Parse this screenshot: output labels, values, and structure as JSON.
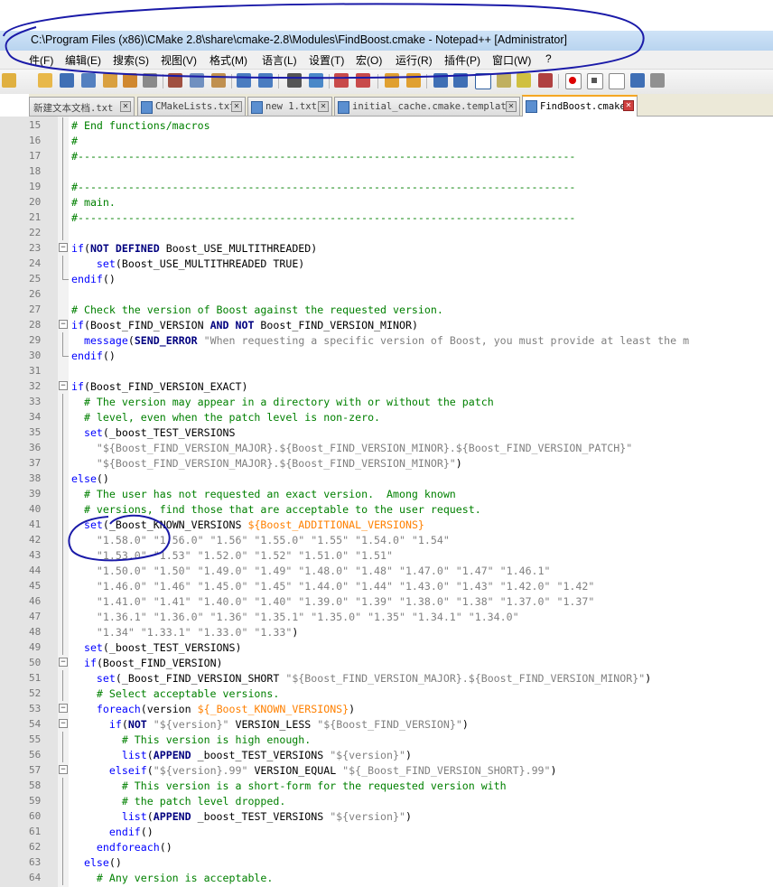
{
  "window": {
    "title": "C:\\Program Files (x86)\\CMake 2.8\\share\\cmake-2.8\\Modules\\FindBoost.cmake - Notepad++ [Administrator]"
  },
  "menu": [
    "件(F)",
    "编辑(E)",
    "搜索(S)",
    "视图(V)",
    "格式(M)",
    "语言(L)",
    "设置(T)",
    "宏(O)",
    "运行(R)",
    "插件(P)",
    "窗口(W)",
    "?"
  ],
  "tabs": [
    {
      "label": "新建文本文档.txt",
      "active": false
    },
    {
      "label": "CMakeLists.txt",
      "active": false
    },
    {
      "label": "new 1.txt",
      "active": false
    },
    {
      "label": "initial_cache.cmake.template",
      "active": false
    },
    {
      "label": "FindBoost.cmake",
      "active": true
    }
  ],
  "icons": {
    "close": "close-icon",
    "file": "file-icon"
  },
  "colors": {
    "comment": "#008000",
    "keyword": "#0000ff",
    "string": "#808080",
    "variable": "#ff8000",
    "annotation": "#1a1aa8",
    "active_tab_accent": "#f5a623"
  },
  "editor": {
    "lines": [
      {
        "n": "15",
        "fold": "line",
        "tokens": [
          [
            "cm",
            "# End functions/macros"
          ]
        ]
      },
      {
        "n": "16",
        "fold": "line",
        "tokens": [
          [
            "cm",
            "#"
          ]
        ]
      },
      {
        "n": "17",
        "fold": "line",
        "tokens": [
          [
            "cm",
            "#-------------------------------------------------------------------------------"
          ]
        ]
      },
      {
        "n": "18",
        "fold": "line",
        "tokens": []
      },
      {
        "n": "19",
        "fold": "line",
        "tokens": [
          [
            "cm",
            "#-------------------------------------------------------------------------------"
          ]
        ]
      },
      {
        "n": "20",
        "fold": "line",
        "tokens": [
          [
            "cm",
            "# main."
          ]
        ]
      },
      {
        "n": "21",
        "fold": "line",
        "tokens": [
          [
            "cm",
            "#-------------------------------------------------------------------------------"
          ]
        ]
      },
      {
        "n": "22",
        "fold": "line",
        "tokens": []
      },
      {
        "n": "23",
        "fold": "open",
        "tokens": [
          [
            "kw",
            "if"
          ],
          [
            "pl",
            "("
          ],
          [
            "kw2",
            "NOT DEFINED"
          ],
          [
            "pl",
            " Boost_USE_MULTITHREADED)"
          ]
        ]
      },
      {
        "n": "24",
        "fold": "line",
        "tokens": [
          [
            "pl",
            "    "
          ],
          [
            "kw",
            "set"
          ],
          [
            "pl",
            "(Boost_USE_MULTITHREADED TRUE)"
          ]
        ]
      },
      {
        "n": "25",
        "fold": "end",
        "tokens": [
          [
            "kw",
            "endif"
          ],
          [
            "pl",
            "()"
          ]
        ]
      },
      {
        "n": "26",
        "fold": "none",
        "tokens": []
      },
      {
        "n": "27",
        "fold": "none",
        "tokens": [
          [
            "cm",
            "# Check the version of Boost against the requested version."
          ]
        ]
      },
      {
        "n": "28",
        "fold": "open",
        "tokens": [
          [
            "kw",
            "if"
          ],
          [
            "pl",
            "(Boost_FIND_VERSION "
          ],
          [
            "kw2",
            "AND NOT"
          ],
          [
            "pl",
            " Boost_FIND_VERSION_MINOR)"
          ]
        ]
      },
      {
        "n": "29",
        "fold": "line",
        "tokens": [
          [
            "pl",
            "  "
          ],
          [
            "kw",
            "message"
          ],
          [
            "pl",
            "("
          ],
          [
            "kw2",
            "SEND_ERROR"
          ],
          [
            "str",
            " \"When requesting a specific version of Boost, you must provide at least the m"
          ]
        ]
      },
      {
        "n": "30",
        "fold": "end",
        "tokens": [
          [
            "kw",
            "endif"
          ],
          [
            "pl",
            "()"
          ]
        ]
      },
      {
        "n": "31",
        "fold": "none",
        "tokens": []
      },
      {
        "n": "32",
        "fold": "open",
        "tokens": [
          [
            "kw",
            "if"
          ],
          [
            "pl",
            "(Boost_FIND_VERSION_EXACT)"
          ]
        ]
      },
      {
        "n": "33",
        "fold": "line",
        "tokens": [
          [
            "pl",
            "  "
          ],
          [
            "cm",
            "# The version may appear in a directory with or without the patch"
          ]
        ]
      },
      {
        "n": "34",
        "fold": "line",
        "tokens": [
          [
            "pl",
            "  "
          ],
          [
            "cm",
            "# level, even when the patch level is non-zero."
          ]
        ]
      },
      {
        "n": "35",
        "fold": "line",
        "tokens": [
          [
            "pl",
            "  "
          ],
          [
            "kw",
            "set"
          ],
          [
            "pl",
            "(_boost_TEST_VERSIONS"
          ]
        ]
      },
      {
        "n": "36",
        "fold": "line",
        "tokens": [
          [
            "pl",
            "    "
          ],
          [
            "str",
            "\"${Boost_FIND_VERSION_MAJOR}.${Boost_FIND_VERSION_MINOR}.${Boost_FIND_VERSION_PATCH}\""
          ]
        ]
      },
      {
        "n": "37",
        "fold": "line",
        "tokens": [
          [
            "pl",
            "    "
          ],
          [
            "str",
            "\"${Boost_FIND_VERSION_MAJOR}.${Boost_FIND_VERSION_MINOR}\""
          ],
          [
            "pl",
            ")"
          ]
        ]
      },
      {
        "n": "38",
        "fold": "line",
        "tokens": [
          [
            "kw",
            "else"
          ],
          [
            "pl",
            "()"
          ]
        ]
      },
      {
        "n": "39",
        "fold": "line",
        "tokens": [
          [
            "pl",
            "  "
          ],
          [
            "cm",
            "# The user has not requested an exact version.  Among known"
          ]
        ]
      },
      {
        "n": "40",
        "fold": "line",
        "tokens": [
          [
            "pl",
            "  "
          ],
          [
            "cm",
            "# versions, find those that are acceptable to the user request."
          ]
        ]
      },
      {
        "n": "41",
        "fold": "line",
        "tokens": [
          [
            "pl",
            "  "
          ],
          [
            "kw",
            "set"
          ],
          [
            "pl",
            "(_Boost_KNOWN_VERSIONS "
          ],
          [
            "var",
            "${Boost_ADDITIONAL_VERSIONS}"
          ]
        ]
      },
      {
        "n": "42",
        "fold": "line",
        "tokens": [
          [
            "pl",
            "    "
          ],
          [
            "str",
            "\"1.58.0\" \"1.56.0\" \"1.56\" \"1.55.0\" \"1.55\" \"1.54.0\" \"1.54\""
          ]
        ]
      },
      {
        "n": "43",
        "fold": "line",
        "tokens": [
          [
            "pl",
            "    "
          ],
          [
            "str",
            "\"1.53.0\" \"1.53\" \"1.52.0\" \"1.52\" \"1.51.0\" \"1.51\""
          ]
        ]
      },
      {
        "n": "44",
        "fold": "line",
        "tokens": [
          [
            "pl",
            "    "
          ],
          [
            "str",
            "\"1.50.0\" \"1.50\" \"1.49.0\" \"1.49\" \"1.48.0\" \"1.48\" \"1.47.0\" \"1.47\" \"1.46.1\""
          ]
        ]
      },
      {
        "n": "45",
        "fold": "line",
        "tokens": [
          [
            "pl",
            "    "
          ],
          [
            "str",
            "\"1.46.0\" \"1.46\" \"1.45.0\" \"1.45\" \"1.44.0\" \"1.44\" \"1.43.0\" \"1.43\" \"1.42.0\" \"1.42\""
          ]
        ]
      },
      {
        "n": "46",
        "fold": "line",
        "tokens": [
          [
            "pl",
            "    "
          ],
          [
            "str",
            "\"1.41.0\" \"1.41\" \"1.40.0\" \"1.40\" \"1.39.0\" \"1.39\" \"1.38.0\" \"1.38\" \"1.37.0\" \"1.37\""
          ]
        ]
      },
      {
        "n": "47",
        "fold": "line",
        "tokens": [
          [
            "pl",
            "    "
          ],
          [
            "str",
            "\"1.36.1\" \"1.36.0\" \"1.36\" \"1.35.1\" \"1.35.0\" \"1.35\" \"1.34.1\" \"1.34.0\""
          ]
        ]
      },
      {
        "n": "48",
        "fold": "line",
        "tokens": [
          [
            "pl",
            "    "
          ],
          [
            "str",
            "\"1.34\" \"1.33.1\" \"1.33.0\" \"1.33\""
          ],
          [
            "pl",
            ")"
          ]
        ]
      },
      {
        "n": "49",
        "fold": "line",
        "tokens": [
          [
            "pl",
            "  "
          ],
          [
            "kw",
            "set"
          ],
          [
            "pl",
            "(_boost_TEST_VERSIONS)"
          ]
        ]
      },
      {
        "n": "50",
        "fold": "open",
        "tokens": [
          [
            "pl",
            "  "
          ],
          [
            "kw",
            "if"
          ],
          [
            "pl",
            "(Boost_FIND_VERSION)"
          ]
        ]
      },
      {
        "n": "51",
        "fold": "line",
        "tokens": [
          [
            "pl",
            "    "
          ],
          [
            "kw",
            "set"
          ],
          [
            "pl",
            "(_Boost_FIND_VERSION_SHORT "
          ],
          [
            "str",
            "\"${Boost_FIND_VERSION_MAJOR}.${Boost_FIND_VERSION_MINOR}\""
          ],
          [
            "pl",
            ")"
          ]
        ]
      },
      {
        "n": "52",
        "fold": "line",
        "tokens": [
          [
            "pl",
            "    "
          ],
          [
            "cm",
            "# Select acceptable versions."
          ]
        ]
      },
      {
        "n": "53",
        "fold": "open",
        "tokens": [
          [
            "pl",
            "    "
          ],
          [
            "kw",
            "foreach"
          ],
          [
            "pl",
            "(version "
          ],
          [
            "var",
            "${_Boost_KNOWN_VERSIONS}"
          ],
          [
            "pl",
            ")"
          ]
        ]
      },
      {
        "n": "54",
        "fold": "open",
        "tokens": [
          [
            "pl",
            "      "
          ],
          [
            "kw",
            "if"
          ],
          [
            "pl",
            "("
          ],
          [
            "kw2",
            "NOT"
          ],
          [
            "str",
            " \"${version}\""
          ],
          [
            "pl",
            " VERSION_LESS "
          ],
          [
            "str",
            "\"${Boost_FIND_VERSION}\""
          ],
          [
            "pl",
            ")"
          ]
        ]
      },
      {
        "n": "55",
        "fold": "line",
        "tokens": [
          [
            "pl",
            "        "
          ],
          [
            "cm",
            "# This version is high enough."
          ]
        ]
      },
      {
        "n": "56",
        "fold": "line",
        "tokens": [
          [
            "pl",
            "        "
          ],
          [
            "kw",
            "list"
          ],
          [
            "pl",
            "("
          ],
          [
            "kw2",
            "APPEND"
          ],
          [
            "pl",
            " _boost_TEST_VERSIONS "
          ],
          [
            "str",
            "\"${version}\""
          ],
          [
            "pl",
            ")"
          ]
        ]
      },
      {
        "n": "57",
        "fold": "open",
        "tokens": [
          [
            "pl",
            "      "
          ],
          [
            "kw",
            "elseif"
          ],
          [
            "pl",
            "("
          ],
          [
            "str",
            "\"${version}.99\""
          ],
          [
            "pl",
            " VERSION_EQUAL "
          ],
          [
            "str",
            "\"${_Boost_FIND_VERSION_SHORT}.99\""
          ],
          [
            "pl",
            ")"
          ]
        ]
      },
      {
        "n": "58",
        "fold": "line",
        "tokens": [
          [
            "pl",
            "        "
          ],
          [
            "cm",
            "# This version is a short-form for the requested version with"
          ]
        ]
      },
      {
        "n": "59",
        "fold": "line",
        "tokens": [
          [
            "pl",
            "        "
          ],
          [
            "cm",
            "# the patch level dropped."
          ]
        ]
      },
      {
        "n": "60",
        "fold": "line",
        "tokens": [
          [
            "pl",
            "        "
          ],
          [
            "kw",
            "list"
          ],
          [
            "pl",
            "("
          ],
          [
            "kw2",
            "APPEND"
          ],
          [
            "pl",
            " _boost_TEST_VERSIONS "
          ],
          [
            "str",
            "\"${version}\""
          ],
          [
            "pl",
            ")"
          ]
        ]
      },
      {
        "n": "61",
        "fold": "line",
        "tokens": [
          [
            "pl",
            "      "
          ],
          [
            "kw",
            "endif"
          ],
          [
            "pl",
            "()"
          ]
        ]
      },
      {
        "n": "62",
        "fold": "line",
        "tokens": [
          [
            "pl",
            "    "
          ],
          [
            "kw",
            "endforeach"
          ],
          [
            "pl",
            "()"
          ]
        ]
      },
      {
        "n": "63",
        "fold": "line",
        "tokens": [
          [
            "pl",
            "  "
          ],
          [
            "kw",
            "else"
          ],
          [
            "pl",
            "()"
          ]
        ]
      },
      {
        "n": "64",
        "fold": "line",
        "tokens": [
          [
            "pl",
            "    "
          ],
          [
            "cm",
            "# Any version is acceptable."
          ]
        ]
      }
    ]
  }
}
